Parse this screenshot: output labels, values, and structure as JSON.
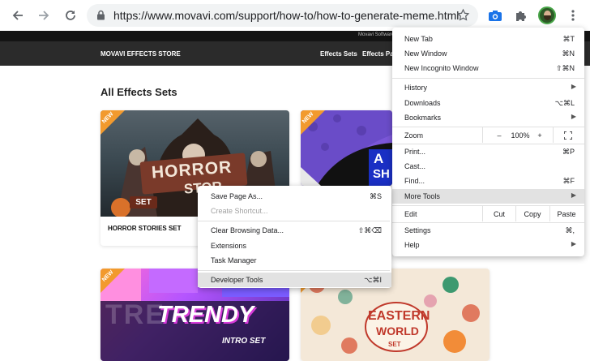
{
  "browser": {
    "url": "https://www.movavi.com/support/how-to/how-to-generate-meme.html",
    "icons": [
      "back-icon",
      "forward-icon",
      "reload-icon",
      "lock-icon",
      "star-icon",
      "camera-icon",
      "puzzle-icon",
      "avatar",
      "kebab-icon"
    ]
  },
  "page": {
    "topstrip_text": "Movavi Software",
    "brand": "MOVAVI EFFECTS STORE",
    "nav": [
      "Effects Sets",
      "Effects Pac"
    ],
    "title": "All Effects Sets",
    "new_badge": "NEW",
    "cards": [
      {
        "caption": "HORROR STORIES SET",
        "art_title": "HORROR",
        "art_sub": "STOR",
        "art_set": "SET"
      },
      {
        "caption": "",
        "art_title": "A",
        "art_sub": "SH"
      },
      {
        "caption": "",
        "art_title": "TRENDY",
        "art_sub": "INTRO SET",
        "art_bg": "TRE"
      },
      {
        "caption": "",
        "art_title": "EASTERN",
        "art_sub": "WORLD",
        "art_set": "SET"
      }
    ]
  },
  "menu": {
    "new_tab": "New Tab",
    "new_tab_sc": "⌘T",
    "new_window": "New Window",
    "new_window_sc": "⌘N",
    "incognito": "New Incognito Window",
    "incognito_sc": "⇧⌘N",
    "history": "History",
    "downloads": "Downloads",
    "downloads_sc": "⌥⌘L",
    "bookmarks": "Bookmarks",
    "zoom": "Zoom",
    "zoom_minus": "–",
    "zoom_level": "100%",
    "zoom_plus": "+",
    "print": "Print...",
    "print_sc": "⌘P",
    "cast": "Cast...",
    "find": "Find...",
    "find_sc": "⌘F",
    "more_tools": "More Tools",
    "edit": "Edit",
    "cut": "Cut",
    "copy": "Copy",
    "paste": "Paste",
    "settings": "Settings",
    "settings_sc": "⌘,",
    "help": "Help"
  },
  "submenu": {
    "save_page": "Save Page As...",
    "save_page_sc": "⌘S",
    "create_shortcut": "Create Shortcut...",
    "clear_data": "Clear Browsing Data...",
    "clear_data_sc": "⇧⌘⌫",
    "extensions": "Extensions",
    "task_manager": "Task Manager",
    "dev_tools": "Developer Tools",
    "dev_tools_sc": "⌥⌘I"
  },
  "colors": {
    "accent_orange": "#f29a2e",
    "menu_highlight": "#e2e2e2",
    "header_dark": "#2b2b2b"
  }
}
